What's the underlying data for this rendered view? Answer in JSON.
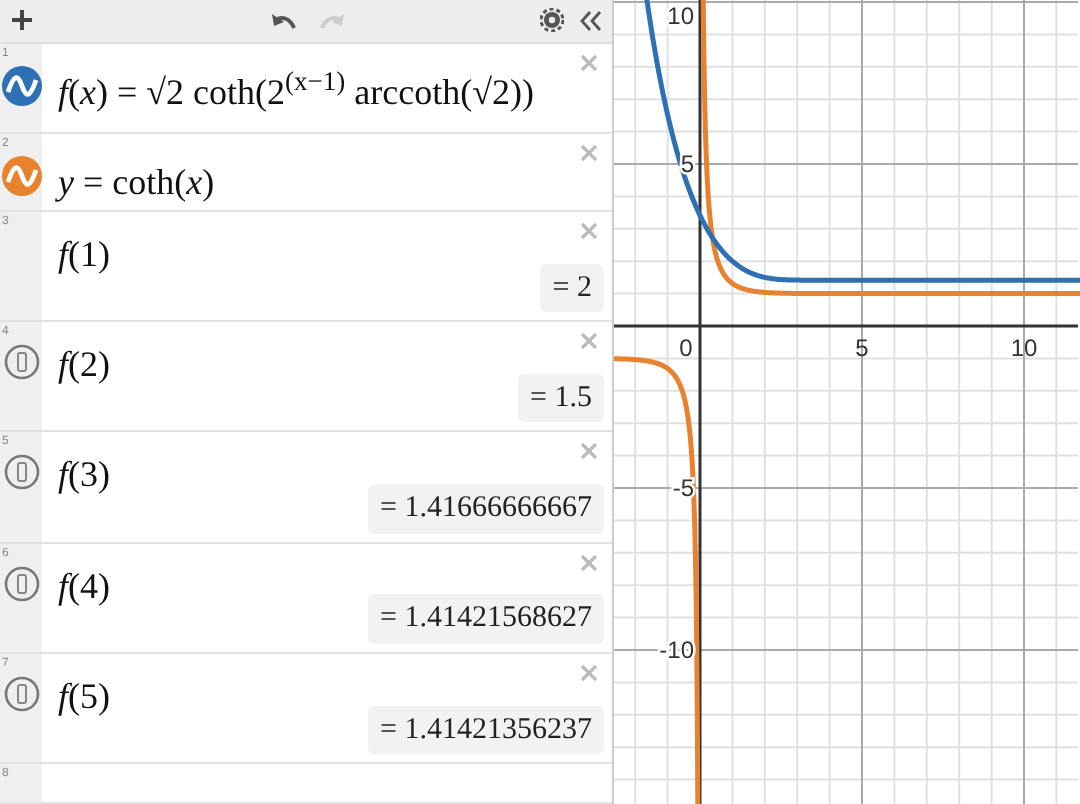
{
  "toolbar": {
    "redo_disabled": true
  },
  "expressions": [
    {
      "number": "1",
      "kind": "graph",
      "color": "#2d70b3",
      "latex": "*f*(*x*) = √2 coth(2$^{(x−1)}$ arccoth(√2))"
    },
    {
      "number": "2",
      "kind": "graph",
      "color": "#e8822f",
      "latex": "*y* = coth(*x*)"
    },
    {
      "number": "3",
      "kind": "value",
      "icon": false,
      "latex": "*f*(1)",
      "result": "= 2"
    },
    {
      "number": "4",
      "kind": "value",
      "icon": true,
      "latex": "*f*(2)",
      "result": "= 1.5"
    },
    {
      "number": "5",
      "kind": "value",
      "icon": true,
      "latex": "*f*(3)",
      "result": "= 1.41666666667"
    },
    {
      "number": "6",
      "kind": "value",
      "icon": true,
      "latex": "*f*(4)",
      "result": "= 1.41421568627"
    },
    {
      "number": "7",
      "kind": "value",
      "icon": true,
      "latex": "*f*(5)",
      "result": "= 1.41421356237"
    },
    {
      "number": "8",
      "kind": "empty"
    }
  ],
  "graph": {
    "x_labels": [
      "0",
      "5",
      "10"
    ],
    "y_labels": [
      "10",
      "5",
      "-5",
      "-10"
    ]
  }
}
